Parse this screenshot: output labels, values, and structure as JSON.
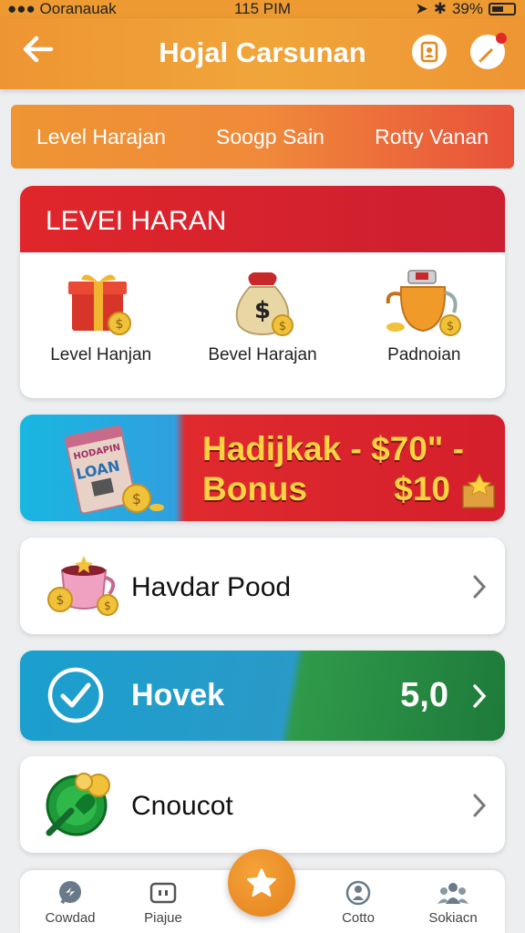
{
  "status": {
    "carrier": "●●● Ooranauak",
    "time": "115 PIM",
    "battery": "39%"
  },
  "header": {
    "title": "Hojal Carsunan",
    "back_icon": "back-arrow-icon",
    "icons": [
      "contact-icon",
      "notification-pen-icon"
    ]
  },
  "tabs": [
    "Level Harajan",
    "Soogp Sain",
    "Rotty Vanan"
  ],
  "level_card": {
    "title": "LEVEI HARAN",
    "items": [
      {
        "label": "Level Hanjan",
        "icon": "gift-box-icon"
      },
      {
        "label": "Bevel Harajan",
        "icon": "money-bag-icon"
      },
      {
        "label": "Padnoian",
        "icon": "teapot-icon"
      }
    ]
  },
  "banner": {
    "line1": "Hadijkak - $70\" -",
    "line2": "Bonus",
    "amount": "$10",
    "pouch_text_1": "HODAPIN",
    "pouch_text_2": "LOAN"
  },
  "rows": [
    {
      "label": "Havdar Pood",
      "icon": "cup-coins-icon"
    },
    {
      "label": "Hovek",
      "value": "5,0",
      "icon": "check-circle-icon"
    },
    {
      "label": "Cnoucot",
      "icon": "green-coin-icon"
    }
  ],
  "nav": [
    {
      "label": "Cowdad",
      "icon": "chat-icon"
    },
    {
      "label": "Piajue",
      "icon": "ticket-icon"
    },
    {
      "label": "Cotto",
      "icon": "person-circle-icon"
    },
    {
      "label": "Sokiacn",
      "icon": "group-icon"
    }
  ],
  "colors": {
    "accent": "#ee9533",
    "red": "#e0262b",
    "gold": "#ffd341",
    "teal": "#1a9fce",
    "green": "#1e7a3a"
  }
}
